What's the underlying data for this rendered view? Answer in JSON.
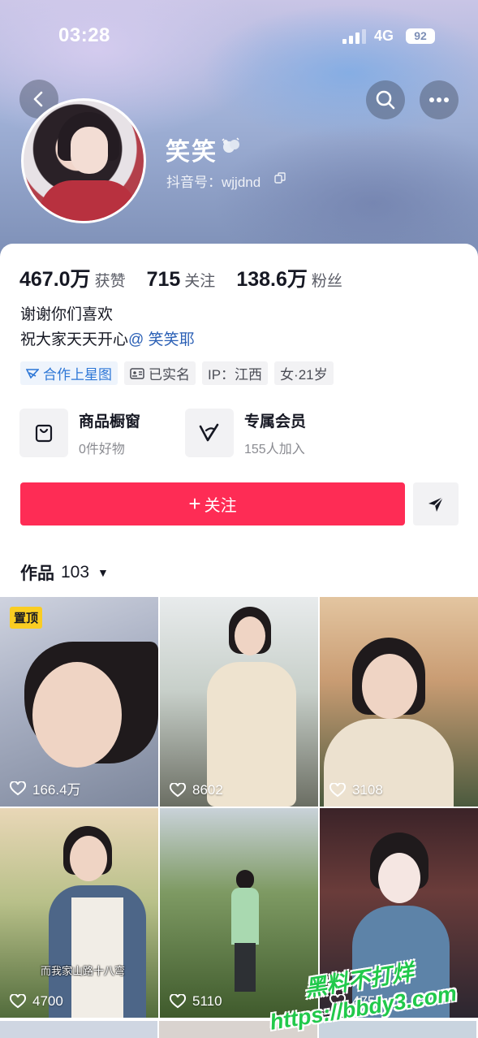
{
  "status_bar": {
    "time": "03:28",
    "network": "4G",
    "battery": "92"
  },
  "profile": {
    "nickname": "笑笑",
    "account_id": "抖音号：wjjdnd",
    "stats": [
      {
        "value": "467.0万",
        "label": "获赞"
      },
      {
        "value": "715",
        "label": "关注"
      },
      {
        "value": "138.6万",
        "label": "粉丝"
      }
    ],
    "bio_line1": "谢谢你们喜欢",
    "bio_line2": "祝大家天天开心",
    "bio_mention": "@ 笑笑耶",
    "tags": [
      "合作上星图",
      "已实名",
      "IP：江西",
      "女·21岁"
    ]
  },
  "services": [
    {
      "title": "商品橱窗",
      "subtitle": "0件好物",
      "icon": "shopping-bag-icon"
    },
    {
      "title": "专属会员",
      "subtitle": "155人加入",
      "icon": "member-v-icon"
    }
  ],
  "actions": {
    "follow": "关注",
    "share_icon": "send-icon"
  },
  "works": {
    "label": "作品",
    "count": "103"
  },
  "grid": [
    {
      "likes": "166.4万",
      "pinned": "置顶"
    },
    {
      "likes": "8602"
    },
    {
      "likes": "3108"
    },
    {
      "likes": "4700",
      "caption": "而我家山路十八弯"
    },
    {
      "likes": "5110"
    },
    {
      "likes": "4755"
    }
  ],
  "watermark": {
    "line1": "黑料不打烊",
    "line2": "https://bbdy3.com"
  },
  "colors": {
    "accent": "#fe2c55",
    "link": "#2a5fb5",
    "pin": "#facd22"
  }
}
